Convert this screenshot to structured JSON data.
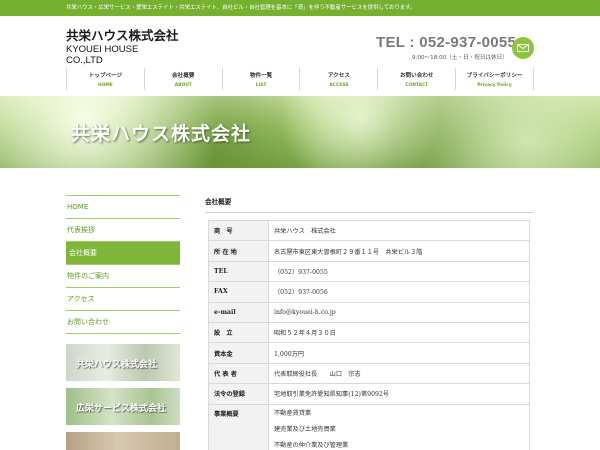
{
  "topbar": {
    "text": "共栄ハウス・広栄サービス・愛栄エステイト・共栄エステイト、自社ビル・自社管理を基本に「貸」を伴う不動産サービスを提供しております。"
  },
  "brand": {
    "jp": "共栄ハウス株式会社",
    "en": "KYOUEI HOUSE CO.,LTD"
  },
  "contact": {
    "tel": "TEL : 052-937-0055",
    "hours": "9:00〜18:00（土・日・祝日は休日）"
  },
  "gnav": [
    {
      "jp": "トップページ",
      "en": "HOME"
    },
    {
      "jp": "会社概要",
      "en": "ABOUT"
    },
    {
      "jp": "物件一覧",
      "en": "LIST"
    },
    {
      "jp": "アクセス",
      "en": "ACCESS"
    },
    {
      "jp": "お問い合わせ",
      "en": "CONTACT"
    },
    {
      "jp": "プライバシーポリシー",
      "en": "Privacy Policy"
    }
  ],
  "hero": {
    "title": "共栄ハウス株式会社"
  },
  "sidenav": [
    "HOME",
    "代表挨拶",
    "会社概要",
    "物件のご案内",
    "アクセス",
    "お問い合わせ"
  ],
  "banners": [
    "共栄ハウス株式会社",
    "広栄サービス株式会社",
    ""
  ],
  "content": {
    "heading": "会社概要",
    "rows": [
      {
        "label": "商　号",
        "value": "共栄ハウス　株式会社"
      },
      {
        "label": "所 在 地",
        "value": "名古屋市東区東大曽根町２９番１１号　共栄ビル３階"
      },
      {
        "label": "TEL",
        "value": "（052）937-0055"
      },
      {
        "label": "FAX",
        "value": "（052）937-0056"
      },
      {
        "label": "e-mail",
        "value": "info@kyouei-h.co.jp"
      },
      {
        "label": "設　立",
        "value": "昭和５２年４月３０日"
      },
      {
        "label": "資本金",
        "value": "1,000万円"
      },
      {
        "label": "代 表 者",
        "value": "代表取締役社長　　山口　宗志"
      },
      {
        "label": "法令の登録",
        "value": "宅地取引業免許愛知県知事(12)第9092号"
      }
    ],
    "business": {
      "label": "事業概要",
      "items": [
        "不動産賃貸業",
        "建売業及び土地売買業",
        "不動産の仲介業及び管理業"
      ]
    }
  },
  "colors": {
    "accent": "#75b02f",
    "nav_active": "#7fb539",
    "link": "#5b9a1e"
  }
}
